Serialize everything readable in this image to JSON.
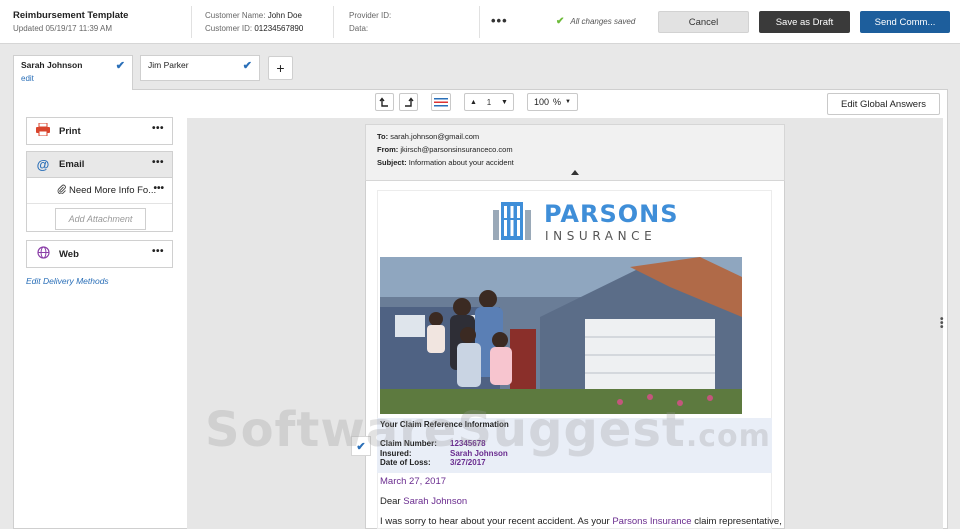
{
  "header": {
    "title": "Reimbursement Template",
    "updated": "Updated 05/19/17 11:39 AM",
    "customer_name_label": "Customer Name:",
    "customer_name": "John Doe",
    "customer_id_label": "Customer ID:",
    "customer_id": "01234567890",
    "provider_id_label": "Provider ID:",
    "data_label": "Data:",
    "more": "•••",
    "saved_status": "All changes saved",
    "cancel": "Cancel",
    "save_draft": "Save as Draft",
    "send": "Send Comm..."
  },
  "tabs": [
    {
      "label": "Sarah Johnson",
      "edit": "edit"
    },
    {
      "label": "Jim Parker"
    }
  ],
  "toolbar": {
    "page": "1",
    "zoom": "100",
    "zoom_unit": "%",
    "global_answers": "Edit Global Answers"
  },
  "sidebar": {
    "print": "Print",
    "email": "Email",
    "email_item": "Need More Info Fo...",
    "add_attachment": "Add Attachment",
    "web": "Web",
    "dots": "•••",
    "edit_delivery": "Edit Delivery Methods"
  },
  "email": {
    "to_label": "To:",
    "to": "sarah.johnson@gmail.com",
    "from_label": "From:",
    "from": "jkirsch@parsonsinsuranceco.com",
    "subject_label": "Subject:",
    "subject": "Information about your accident",
    "logo_main": "PARSONS",
    "logo_sub": "INSURANCE",
    "claim_title": "Your Claim Reference Information",
    "claim_number_label": "Claim Number:",
    "claim_number": "12345678",
    "insured_label": "Insured:",
    "insured": "Sarah Johnson",
    "date_of_loss_label": "Date of Loss:",
    "date_of_loss": "3/27/2017",
    "letter_date": "March 27, 2017",
    "dear": "Dear",
    "dear_name": "Sarah Johnson",
    "body_start": "I was sorry to hear about your recent accident.  As your",
    "body_company": "Parsons Insurance",
    "body_end": "claim representative,"
  },
  "watermark": {
    "main": "SoftwareSuggest",
    "suffix": ".com"
  },
  "colors": {
    "accent": "#1d5e9c",
    "link": "#2a6fb8",
    "value": "#6a2c8f",
    "saved_check": "#6dbb3a"
  }
}
